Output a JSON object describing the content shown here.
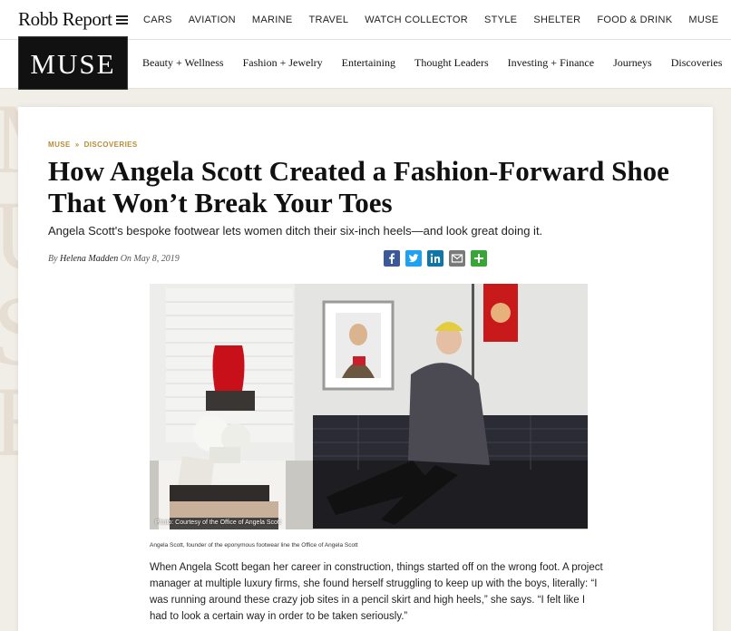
{
  "site": {
    "logo": "Robb Report",
    "nav": [
      "CARS",
      "AVIATION",
      "MARINE",
      "TRAVEL",
      "WATCH COLLECTOR",
      "STYLE",
      "SHELTER",
      "FOOD & DRINK",
      "MUSE"
    ]
  },
  "section": {
    "logo": "MUSE",
    "nav": [
      "Beauty + Wellness",
      "Fashion + Jewelry",
      "Entertaining",
      "Thought Leaders",
      "Investing + Finance",
      "Journeys",
      "Discoveries"
    ]
  },
  "background_letters": [
    "M",
    "U",
    "S",
    "E"
  ],
  "article": {
    "breadcrumb": [
      "MUSE",
      "DISCOVERIES"
    ],
    "breadcrumb_separator": "»",
    "headline": "How Angela Scott Created a Fashion-Forward Shoe That Won’t Break Your Toes",
    "dek": "Angela Scott's bespoke footwear lets women ditch their six-inch heels—and look great doing it.",
    "byline": {
      "by": "By",
      "author": "Helena Madden",
      "on": "On",
      "date": "May 8, 2019"
    },
    "share": [
      {
        "name": "facebook",
        "color": "#3b5998"
      },
      {
        "name": "twitter",
        "color": "#1da1f2"
      },
      {
        "name": "linkedin",
        "color": "#0e76a8"
      },
      {
        "name": "email",
        "color": "#7a7a7a"
      },
      {
        "name": "more",
        "color": "#38a537"
      }
    ],
    "photo_credit": "Photo: Courtesy of the Office of Angela Scott",
    "caption": "Angela Scott, founder of the eponymous footwear line the Office of Angela Scott",
    "body": "When Angela Scott began her career in construction, things started off on the wrong foot. A project manager at multiple luxury firms, she found herself struggling to keep up with the boys, literally: “I was running around these crazy job sites in a pencil skirt and high heels,” she says. “I felt like I had to look a certain way in order to be taken seriously.”"
  },
  "colors": {
    "accent": "#b58d3a",
    "page_bg": "#f1ede7"
  }
}
